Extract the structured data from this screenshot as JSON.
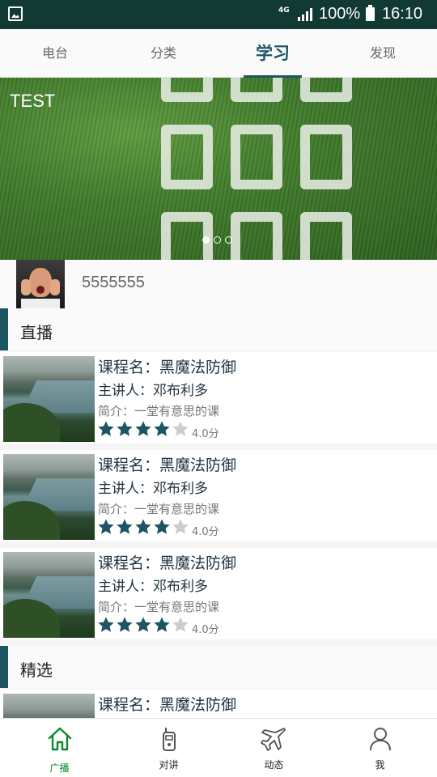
{
  "status_bar": {
    "network": "4G",
    "battery": "100%",
    "time": "16:10"
  },
  "tabs": [
    {
      "label": "电台"
    },
    {
      "label": "分类"
    },
    {
      "label": "学习",
      "active": true
    },
    {
      "label": "发现"
    }
  ],
  "banner": {
    "label": "TEST",
    "page_count": 3,
    "current_page": 1
  },
  "user": {
    "name": "5555555"
  },
  "sections": {
    "live": "直播",
    "featured": "精选"
  },
  "courses": [
    {
      "name": "课程名：黑魔法防御",
      "lecturer": "主讲人：邓布利多",
      "intro": "简介：一堂有意思的课",
      "rating": 4,
      "score": "4.0分"
    },
    {
      "name": "课程名：黑魔法防御",
      "lecturer": "主讲人：邓布利多",
      "intro": "简介：一堂有意思的课",
      "rating": 4,
      "score": "4.0分"
    },
    {
      "name": "课程名：黑魔法防御",
      "lecturer": "主讲人：邓布利多",
      "intro": "简介：一堂有意思的课",
      "rating": 4,
      "score": "4.0分"
    }
  ],
  "featured_courses": [
    {
      "name": "课程名：黑魔法防御"
    }
  ],
  "bottom_nav": [
    {
      "label": "广播",
      "icon": "home-icon",
      "active": true
    },
    {
      "label": "对讲",
      "icon": "walkie-talkie-icon"
    },
    {
      "label": "动态",
      "icon": "airplane-icon"
    },
    {
      "label": "我",
      "icon": "person-icon"
    }
  ],
  "colors": {
    "accent": "#1d5563",
    "star_filled": "#1d5563",
    "star_empty": "#cccccc",
    "nav_active": "#0a8a2e",
    "status_bar": "#123a34"
  }
}
